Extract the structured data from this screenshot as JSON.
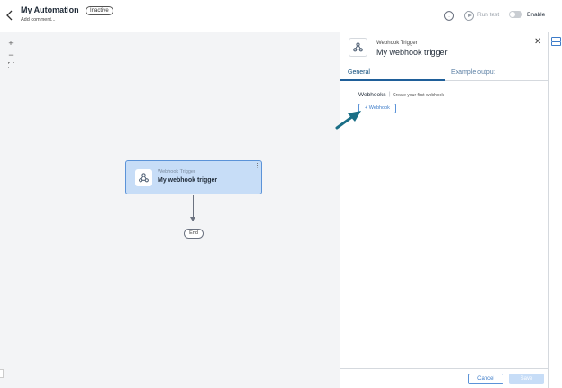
{
  "header": {
    "title": "My Automation",
    "status_badge": "Inactive",
    "add_comment": "Add comment...",
    "run_test_label": "Run test",
    "enable_label": "Enable"
  },
  "canvas": {
    "zoom": {
      "zoom_in": "+",
      "zoom_out": "−"
    },
    "trigger_node": {
      "type": "Webhook Trigger",
      "name": "My webhook trigger"
    },
    "end_node": "End"
  },
  "panel": {
    "type": "Webhook Trigger",
    "name": "My webhook trigger",
    "tabs": [
      {
        "label": "General",
        "active": true
      },
      {
        "label": "Example output",
        "active": false
      }
    ],
    "webhooks_label": "Webhooks",
    "webhooks_separator": "|",
    "webhooks_hint": "Create your first webhook",
    "add_webhook_button": "+ Webhook",
    "cancel_button": "Cancel",
    "save_button": "Save"
  },
  "colors": {
    "accent": "#3d7cc9",
    "node_fill": "#c7ddf7",
    "annotation_arrow": "#1a6e86",
    "canvas_bg": "#f3f4f6"
  },
  "icons": {
    "back": "chevron-left-icon",
    "info": "info-icon",
    "run": "play-circle-icon",
    "webhook": "webhook-icon",
    "close": "close-icon",
    "panel_toggle": "panel-toggle-icon"
  }
}
